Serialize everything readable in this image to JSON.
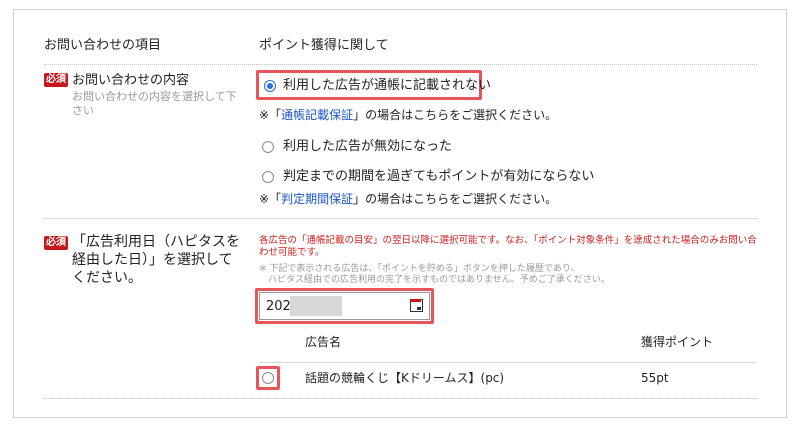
{
  "row1": {
    "label": "お問い合わせの項目",
    "value": "ポイント獲得に関して"
  },
  "row2": {
    "required_badge": "必須",
    "label": "お問い合わせの内容",
    "hint_line1": "お問い合わせの内容を選択して下",
    "hint_line2": "さい",
    "options": [
      {
        "label": "利用した広告が通帳に記載されない",
        "checked": true
      },
      {
        "label": "利用した広告が無効になった",
        "checked": false
      },
      {
        "label": "判定までの期間を過ぎてもポイントが有効にならない",
        "checked": false
      }
    ],
    "note1": {
      "prefix": "※「",
      "link": "通帳記載保証",
      "suffix": "」の場合はこちらをご選択ください。"
    },
    "note2": {
      "prefix": "※「",
      "link": "判定期間保証",
      "suffix": "」の場合はこちらをご選択ください。"
    }
  },
  "row3": {
    "required_badge": "必須",
    "label_line1": "「広告利用日（ハピタスを",
    "label_line2": "経由した日）」を選択して",
    "label_line3": "ください。",
    "warning_line1": "各広告の「通帳記載の目安」の翌日以降に選択可能です。なお、「ポイント対象条件」を達成された場合のみお問い合",
    "warning_line2": "わせ可能です。",
    "note_line1": "※ 下記で表示される広告は、「ポイントを貯める」ボタンを押した履歴であり、",
    "note_line2": "　ハピタス経由での広告利用の完了を示すものではありません。予めご了承ください。",
    "date_value": "2021",
    "table": {
      "headers": [
        "広告名",
        "獲得ポイント"
      ],
      "rows": [
        {
          "name": "話題の競輪くじ【Kドリームス】(pc)",
          "points": "55pt"
        }
      ]
    }
  },
  "colors": {
    "required": "#c8161d",
    "highlight": "#e8555a",
    "link": "#1a56c8",
    "warning": "#d11b1b",
    "radio_checked": "#2b6fe0"
  }
}
